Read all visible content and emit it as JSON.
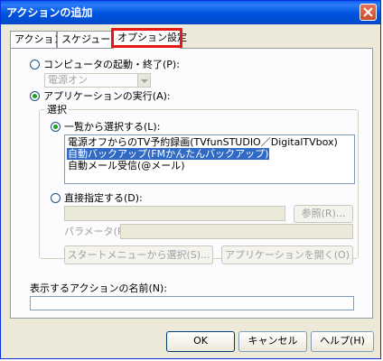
{
  "window": {
    "title": "アクションの追加"
  },
  "tabs": [
    {
      "label": "アクション"
    },
    {
      "label": "スケジュール"
    },
    {
      "label": "オプション設定"
    }
  ],
  "power_option": {
    "label": "コンピュータの起動・終了(P):",
    "select_value": "電源オン"
  },
  "app_option": {
    "label": "アプリケーションの実行(A):"
  },
  "selection_group": {
    "title": "選択",
    "from_list_label": "一覧から選択する(L):",
    "list_items": [
      "電源オフからのTV予約録画(TVfunSTUDIO／DigitalTVbox)",
      "自動バックアップ(FMかんたんバックアップ)",
      "自動メール受信(@メール)"
    ],
    "direct_label": "直接指定する(D):",
    "browse_label": "参照(R)...",
    "param_label": "パラメータ(R):",
    "start_menu_label": "スタートメニューから選択(S)...",
    "open_app_label": "アプリケーションを開く(O)"
  },
  "action_name": {
    "label": "表示するアクションの名前(N):",
    "value": ""
  },
  "buttons": {
    "ok": "OK",
    "cancel": "キャンセル",
    "help": "ヘルプ(H)"
  },
  "colors": {
    "titlebar": "#0054e3",
    "highlight": "#e51717",
    "selection": "#316ac5"
  }
}
